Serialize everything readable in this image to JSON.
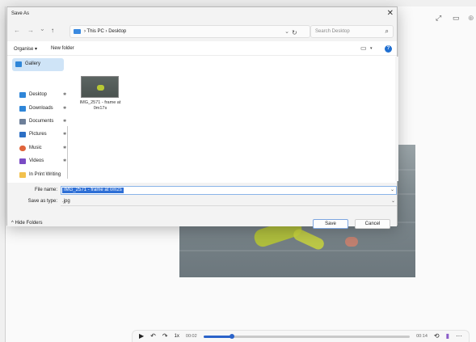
{
  "dialog": {
    "title": "Save As",
    "close_glyph": "✕"
  },
  "nav": {
    "back_glyph": "←",
    "forward_glyph": "→",
    "recent_glyph": "⌄",
    "up_glyph": "↑",
    "breadcrumb": "› This PC › Desktop",
    "address_chevron": "⌄",
    "refresh_glyph": "↻"
  },
  "search": {
    "placeholder": "Search Desktop",
    "icon": "search-icon"
  },
  "commandbar": {
    "organise_label": "Organise ▾",
    "new_folder_label": "New folder",
    "view_icon": "▭",
    "view_chevron": "▾",
    "help_icon": "?"
  },
  "sidebar": {
    "gallery_label": "Gallery",
    "items": [
      {
        "label": "Desktop",
        "icon": "desktop-icon",
        "color": "#2f86d8"
      },
      {
        "label": "Downloads",
        "icon": "download-icon",
        "color": "#2f86d8"
      },
      {
        "label": "Documents",
        "icon": "document-icon",
        "color": "#6d7f99"
      },
      {
        "label": "Pictures",
        "icon": "pictures-icon",
        "color": "#2c6fc4"
      },
      {
        "label": "Music",
        "icon": "music-icon",
        "color": "#e0643b"
      },
      {
        "label": "Videos",
        "icon": "videos-icon",
        "color": "#7a4bc4"
      },
      {
        "label": "In Print Writing",
        "icon": "folder-icon",
        "color": "#f2c14e"
      }
    ],
    "pin_glyph": "✱"
  },
  "content": {
    "files": [
      {
        "name": "IMG_2571 - frame at 0m17s"
      }
    ]
  },
  "form": {
    "filename_label": "File name:",
    "filename_value": "IMG_2571 - frame at 0m2s",
    "filetype_label": "Save as type:",
    "filetype_value": ".jpg",
    "chevron": "⌄"
  },
  "footer": {
    "hide_folders_label": "^ Hide Folders",
    "save_label": "Save",
    "cancel_label": "Cancel"
  },
  "player": {
    "expand_glyph": "⤢",
    "miniplayer_glyph": "▭",
    "zoom_glyph": "⊕",
    "play_glyph": "▶",
    "skip_back_glyph": "↶",
    "skip_fwd_glyph": "↷",
    "speed_label": "1x",
    "time_current": "00:02",
    "time_total": "00:14",
    "progress": 0.14,
    "loop_glyph": "⟲",
    "more_glyph": "···",
    "accent_color": "#2b63c9"
  }
}
